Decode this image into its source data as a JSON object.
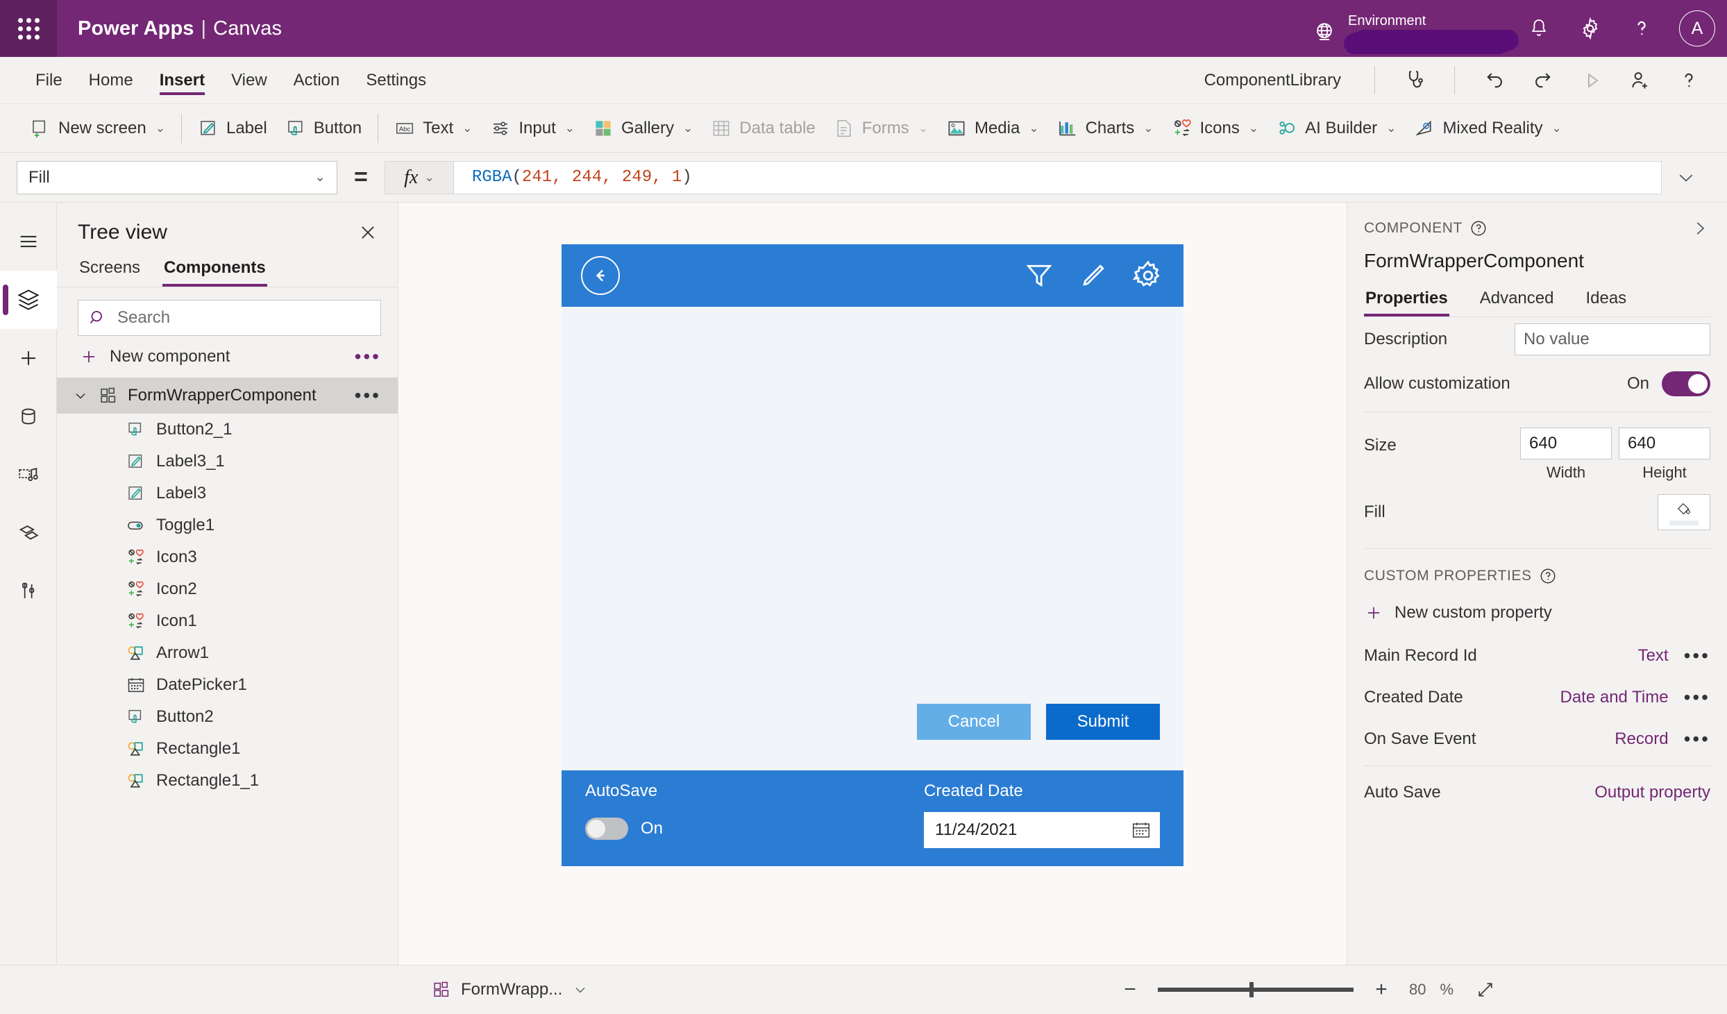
{
  "topbar": {
    "waffle_label": "app-launcher",
    "brand": "Power Apps",
    "separator": "|",
    "brand_sub": "Canvas",
    "environment_label": "Environment",
    "environment_value": "",
    "avatar_initial": "A",
    "icons": [
      "globe-icon",
      "bell-icon",
      "gear-icon",
      "help-icon"
    ]
  },
  "menubar": {
    "items": [
      {
        "label": "File",
        "active": false
      },
      {
        "label": "Home",
        "active": false
      },
      {
        "label": "Insert",
        "active": true
      },
      {
        "label": "View",
        "active": false
      },
      {
        "label": "Action",
        "active": false
      },
      {
        "label": "Settings",
        "active": false
      }
    ],
    "app_name": "ComponentLibrary",
    "right_icons": [
      "stethoscope-icon",
      "undo-icon",
      "redo-icon",
      "play-icon",
      "share-user-icon",
      "help-icon"
    ]
  },
  "ribbon": {
    "items": [
      {
        "label": "New screen",
        "icon": "new-screen-icon",
        "caret": true,
        "disabled": false
      },
      {
        "label": "Label",
        "icon": "label-icon",
        "caret": false,
        "disabled": false
      },
      {
        "label": "Button",
        "icon": "button-icon",
        "caret": false,
        "disabled": false
      },
      {
        "label": "Text",
        "icon": "text-icon",
        "caret": true,
        "disabled": false
      },
      {
        "label": "Input",
        "icon": "input-icon",
        "caret": true,
        "disabled": false
      },
      {
        "label": "Gallery",
        "icon": "gallery-icon",
        "caret": true,
        "disabled": false
      },
      {
        "label": "Data table",
        "icon": "data-table-icon",
        "caret": false,
        "disabled": true
      },
      {
        "label": "Forms",
        "icon": "forms-icon",
        "caret": true,
        "disabled": true
      },
      {
        "label": "Media",
        "icon": "media-icon",
        "caret": true,
        "disabled": false
      },
      {
        "label": "Charts",
        "icon": "charts-icon",
        "caret": true,
        "disabled": false
      },
      {
        "label": "Icons",
        "icon": "icons-icon",
        "caret": true,
        "disabled": false
      },
      {
        "label": "AI Builder",
        "icon": "ai-builder-icon",
        "caret": true,
        "disabled": false
      },
      {
        "label": "Mixed Reality",
        "icon": "mixed-reality-icon",
        "caret": true,
        "disabled": false
      }
    ]
  },
  "formulabar": {
    "property": "Fill",
    "equals": "=",
    "fx_label": "fx",
    "formula_fn": "RGBA",
    "formula_open": "(",
    "formula_args": "241, 244, 249, 1",
    "formula_close": ")"
  },
  "rail": {
    "items": [
      {
        "name": "hamburger-icon",
        "active": false
      },
      {
        "name": "tree-view-icon",
        "active": true
      },
      {
        "name": "insert-icon",
        "active": false
      },
      {
        "name": "data-icon",
        "active": false
      },
      {
        "name": "media-icon",
        "active": false
      },
      {
        "name": "power-automate-icon",
        "active": false
      },
      {
        "name": "tools-icon",
        "active": false
      }
    ]
  },
  "treeview": {
    "title": "Tree view",
    "tabs": [
      {
        "label": "Screens",
        "active": false
      },
      {
        "label": "Components",
        "active": true
      }
    ],
    "search_placeholder": "Search",
    "search_value": "",
    "new_component": "New component",
    "root": {
      "label": "FormWrapperComponent",
      "expanded": true,
      "icon": "component-icon"
    },
    "children": [
      {
        "label": "Button2_1",
        "icon": "button-icon"
      },
      {
        "label": "Label3_1",
        "icon": "label-icon"
      },
      {
        "label": "Label3",
        "icon": "label-icon"
      },
      {
        "label": "Toggle1",
        "icon": "toggle-icon"
      },
      {
        "label": "Icon3",
        "icon": "icons-icon"
      },
      {
        "label": "Icon2",
        "icon": "icons-icon"
      },
      {
        "label": "Icon1",
        "icon": "icons-icon"
      },
      {
        "label": "Arrow1",
        "icon": "shape-icon"
      },
      {
        "label": "DatePicker1",
        "icon": "datepicker-icon"
      },
      {
        "label": "Button2",
        "icon": "button-icon"
      },
      {
        "label": "Rectangle1",
        "icon": "shape-icon"
      },
      {
        "label": "Rectangle1_1",
        "icon": "shape-icon"
      }
    ]
  },
  "canvas": {
    "fill_color": "#F1F4F9",
    "header_color": "#2B7CD3",
    "header_icons": [
      "filter-icon",
      "pencil-icon",
      "gear-icon"
    ],
    "back_icon": "back-arrow-icon",
    "cancel_label": "Cancel",
    "submit_label": "Submit",
    "cancel_color": "#64AEE8",
    "submit_color": "#0B6BCB",
    "autosave_label": "AutoSave",
    "autosave_state": "On",
    "created_date_label": "Created Date",
    "created_date_value": "11/24/2021",
    "calendar_icon": "calendar-icon"
  },
  "properties": {
    "kicker": "COMPONENT",
    "title": "FormWrapperComponent",
    "tabs": [
      {
        "label": "Properties",
        "active": true
      },
      {
        "label": "Advanced",
        "active": false
      },
      {
        "label": "Ideas",
        "active": false
      }
    ],
    "description_label": "Description",
    "description_value": "No value",
    "allow_customization_label": "Allow customization",
    "allow_customization_state": "On",
    "size_label": "Size",
    "width_value": "640",
    "height_value": "640",
    "width_caption": "Width",
    "height_caption": "Height",
    "fill_label": "Fill",
    "custom_properties_title": "CUSTOM PROPERTIES",
    "new_custom_property": "New custom property",
    "custom_properties": [
      {
        "name": "Main Record Id",
        "type": "Text",
        "has_menu": true
      },
      {
        "name": "Created Date",
        "type": "Date and Time",
        "has_menu": true
      },
      {
        "name": "On Save Event",
        "type": "Record",
        "has_menu": true
      }
    ],
    "output_properties": [
      {
        "name": "Auto Save",
        "type": "Output property",
        "has_menu": false
      }
    ],
    "accent_color": "#742774"
  },
  "statusbar": {
    "component_name": "FormWrapp...",
    "zoom_minus": "−",
    "zoom_plus": "+",
    "zoom_value": "80",
    "zoom_unit": "%",
    "expand_icon": "fit-screen-icon"
  }
}
